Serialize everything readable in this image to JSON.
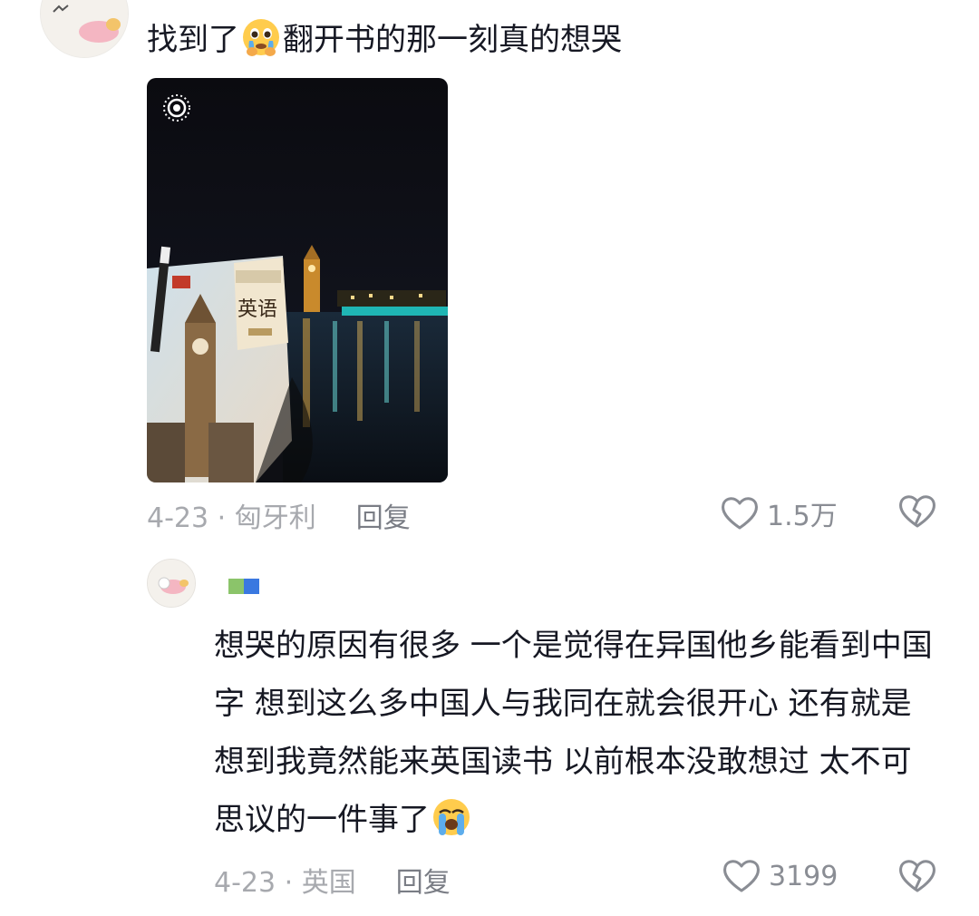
{
  "comments": [
    {
      "text_before_emoji": "找到了",
      "emoji": "pleading-crying-face",
      "text_after_emoji": "翻开书的那一刻真的想哭",
      "photo": {
        "book_title": "英语",
        "description_icon": "live-photo-icon"
      },
      "date_location": "4-23 · 匈牙利",
      "reply_label": "回复",
      "like_count": "1.5万"
    },
    {
      "text": "想哭的原因有很多 一个是觉得在异国他乡能看到中国字 想到这么多中国人与我同在就会很开心 还有就是想到我竟然能来英国读书 以前根本没敢想过 太不可思议的一件事了",
      "emoji": "loudly-crying-face",
      "date_location": "4-23 · 英国",
      "reply_label": "回复",
      "like_count": "3199"
    }
  ],
  "colors": {
    "text": "#161823",
    "meta": "#a7a9ae",
    "icon": "#8a8d94",
    "username_green": "#8bc46a",
    "username_blue": "#3a78e0"
  }
}
